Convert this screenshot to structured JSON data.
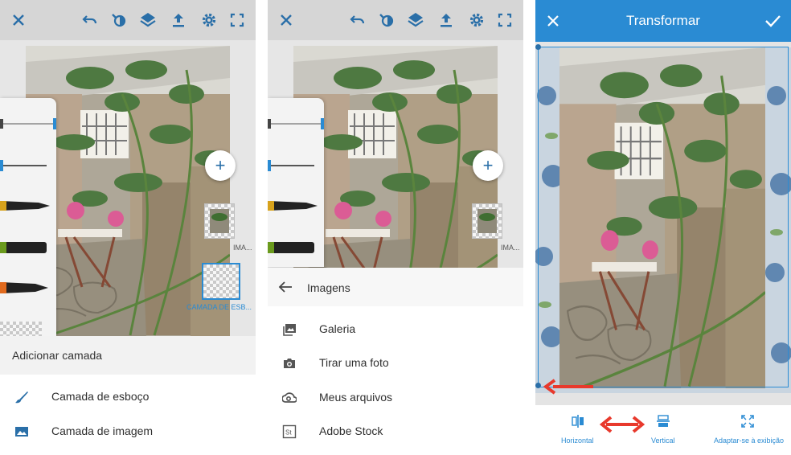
{
  "colors": {
    "accent": "#2a8bd3",
    "arrow": "#e8392c",
    "toolbar_icon": "#2a6fa8"
  },
  "toolbar_icons": [
    "close-icon",
    "undo-icon",
    "eyedropper-icon",
    "layers-icon",
    "export-icon",
    "gear-icon",
    "fullscreen-icon"
  ],
  "screen1": {
    "layers": [
      {
        "label": "IMA..."
      },
      {
        "label": "CAMADA DE ESB..."
      }
    ],
    "sheet": {
      "title": "Adicionar camada",
      "items": [
        {
          "icon": "brush-icon",
          "label": "Camada de esboço"
        },
        {
          "icon": "image-icon",
          "label": "Camada de imagem"
        }
      ]
    }
  },
  "screen2": {
    "layers": [
      {
        "label": "IMA..."
      }
    ],
    "sheet": {
      "back_icon": "back-arrow-icon",
      "title": "Imagens",
      "items": [
        {
          "icon": "gallery-icon",
          "label": "Galeria"
        },
        {
          "icon": "camera-icon",
          "label": "Tirar uma foto"
        },
        {
          "icon": "creative-cloud-icon",
          "label": "Meus arquivos"
        },
        {
          "icon": "stock-icon",
          "label": "Adobe Stock"
        }
      ]
    }
  },
  "screen3": {
    "title": "Transformar",
    "tools": [
      {
        "icon": "flip-horizontal-icon",
        "label": "Horizontal"
      },
      {
        "icon": "flip-vertical-icon",
        "label": "Vertical"
      },
      {
        "icon": "fit-to-view-icon",
        "label": "Adaptar-se à exibição"
      }
    ]
  }
}
